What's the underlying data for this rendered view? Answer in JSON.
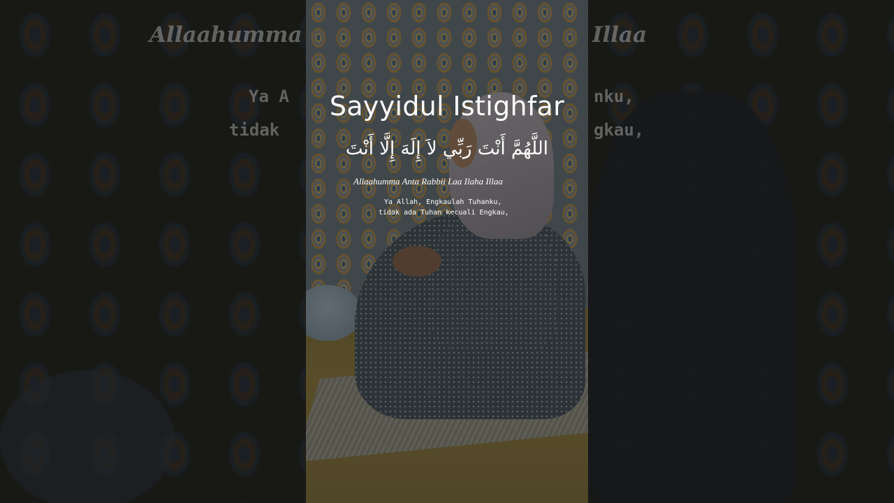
{
  "video": {
    "title": "Sayyidul Istighfar",
    "arabic": "اللَّهُمَّ أَنْتَ رَبِّي لاَ إِلَهَ إِلَّا أَنْتَ",
    "transliteration": "Allaahumma Anta Rabbii Laa Ilaha Illaa",
    "meaning_line1": "Ya Allah, Engkaulah Tuhanku,",
    "meaning_line2": "tidak ada Tuhan kecuali Engkau,"
  },
  "background_left": {
    "title_fragment": "Allaahumma",
    "line1_fragment": "Ya A",
    "line2_fragment": "tidak"
  },
  "background_right": {
    "title_fragment": "Illaa",
    "line1_fragment": "nku,",
    "line2_fragment": "gkau,"
  },
  "colors": {
    "text": "#ffffff",
    "page_background": "#1b1c1c"
  }
}
